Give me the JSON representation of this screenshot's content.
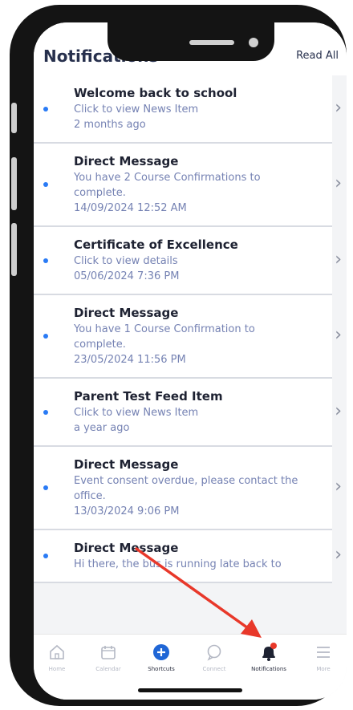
{
  "header": {
    "title": "Notifications",
    "read_all": "Read All"
  },
  "notifications": [
    {
      "title": "Welcome back to school",
      "subtitle": "Click to view News Item",
      "date": "2 months ago"
    },
    {
      "title": "Direct Message",
      "subtitle": "You have 2 Course Confirmations to complete.",
      "date": "14/09/2024 12:52 AM"
    },
    {
      "title": "Certificate of Excellence",
      "subtitle": "Click to view details",
      "date": "05/06/2024 7:36 PM"
    },
    {
      "title": "Direct Message",
      "subtitle": "You have 1 Course Confirmation to complete.",
      "date": "23/05/2024 11:56 PM"
    },
    {
      "title": "Parent Test Feed Item",
      "subtitle": "Click to view News Item",
      "date": "a year ago"
    },
    {
      "title": "Direct Message",
      "subtitle": "Event consent overdue, please contact the office.",
      "date": "13/03/2024 9:06 PM"
    },
    {
      "title": "Direct Message",
      "subtitle": "Hi there, the bus is running late back to",
      "date": ""
    }
  ],
  "tabs": [
    {
      "label": "Home",
      "icon": "home-icon"
    },
    {
      "label": "Calendar",
      "icon": "calendar-icon"
    },
    {
      "label": "Shortcuts",
      "icon": "plus-circle-icon"
    },
    {
      "label": "Connect",
      "icon": "chat-bubble-icon"
    },
    {
      "label": "Notifications",
      "icon": "bell-icon"
    },
    {
      "label": "More",
      "icon": "hamburger-menu-icon"
    }
  ],
  "colors": {
    "accent": "#2a7bf5",
    "arrow": "#e8382a",
    "badge": "#e8382a",
    "title": "#27304d"
  }
}
